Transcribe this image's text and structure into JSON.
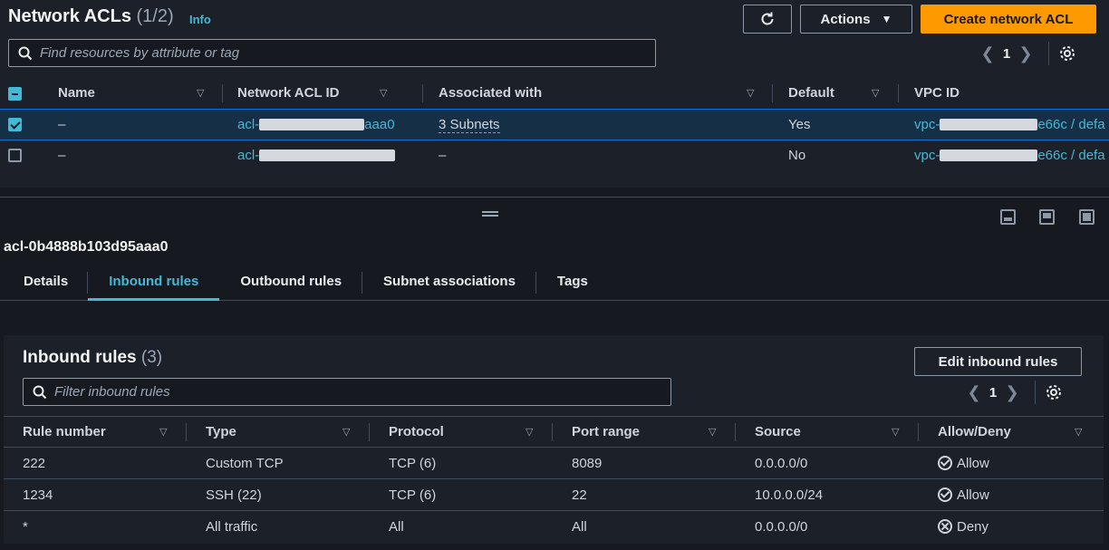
{
  "header": {
    "title": "Network ACLs",
    "count": "(1/2)",
    "info": "Info",
    "actions_label": "Actions",
    "create_label": "Create network ACL"
  },
  "search": {
    "placeholder": "Find resources by attribute or tag"
  },
  "pager": {
    "page": "1"
  },
  "acl_table": {
    "columns": [
      "Name",
      "Network ACL ID",
      "Associated with",
      "Default",
      "VPC ID"
    ],
    "rows": [
      {
        "selected": true,
        "name": "–",
        "acl_prefix": "acl-",
        "acl_suffix": "aaa0",
        "associated": "3 Subnets",
        "default": "Yes",
        "vpc_prefix": "vpc-",
        "vpc_suffix": "e66c / defa"
      },
      {
        "selected": false,
        "name": "–",
        "acl_prefix": "acl-",
        "acl_suffix": "",
        "associated": "–",
        "default": "No",
        "vpc_prefix": "vpc-",
        "vpc_suffix": "e66c / defa"
      }
    ]
  },
  "detail": {
    "title": "acl-0b4888b103d95aaa0",
    "tabs": [
      "Details",
      "Inbound rules",
      "Outbound rules",
      "Subnet associations",
      "Tags"
    ],
    "active_tab": "Inbound rules"
  },
  "inbound": {
    "title": "Inbound rules",
    "count": "(3)",
    "edit_label": "Edit inbound rules",
    "filter_placeholder": "Filter inbound rules",
    "page": "1",
    "columns": [
      "Rule number",
      "Type",
      "Protocol",
      "Port range",
      "Source",
      "Allow/Deny"
    ],
    "rows": [
      {
        "rule": "222",
        "type": "Custom TCP",
        "protocol": "TCP (6)",
        "port": "8089",
        "source": "0.0.0.0/0",
        "action": "Allow"
      },
      {
        "rule": "1234",
        "type": "SSH (22)",
        "protocol": "TCP (6)",
        "port": "22",
        "source": "10.0.0.0/24",
        "action": "Allow"
      },
      {
        "rule": "*",
        "type": "All traffic",
        "protocol": "All",
        "port": "All",
        "source": "0.0.0.0/0",
        "action": "Deny"
      }
    ]
  },
  "colors": {
    "accent": "#44b9d6",
    "primary_button": "#ff9900",
    "allow": "#5fba5c",
    "deny": "#ff5d64"
  },
  "icons": [
    "refresh-icon",
    "caret-down-icon",
    "search-icon",
    "chevron-left-icon",
    "chevron-right-icon",
    "settings-gear-icon",
    "sort-icon",
    "drag-handle-icon",
    "pane-bottom-icon",
    "pane-side-icon",
    "pane-full-icon",
    "allow-check-icon",
    "deny-x-icon"
  ]
}
